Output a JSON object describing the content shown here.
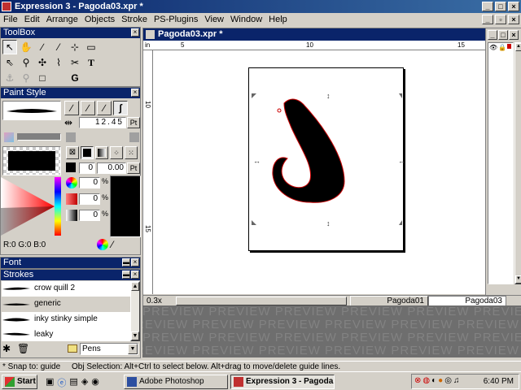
{
  "window": {
    "title": "Expression 3 - Pagoda03.xpr *"
  },
  "menu": [
    "File",
    "Edit",
    "Arrange",
    "Objects",
    "Stroke",
    "PS-Plugins",
    "View",
    "Window",
    "Help"
  ],
  "toolbox": {
    "title": "ToolBox"
  },
  "paint_style": {
    "title": "Paint Style",
    "stroke_width": "12.45",
    "stroke_unit": "Pt",
    "offset_a": "0",
    "offset_b": "0.00",
    "offset_unit": "Pt",
    "opacity_1": "0",
    "opacity_2": "0",
    "opacity_3": "0",
    "percent": "%",
    "rgb_readout": "R:0 G:0 B:0"
  },
  "font_panel": {
    "title": "Font"
  },
  "strokes_panel": {
    "title": "Strokes",
    "items": [
      "crow quill 2",
      "generic",
      "inky stinky simple",
      "leaky"
    ],
    "selected": "generic",
    "category": "Pens"
  },
  "document": {
    "title": "Pagoda03.xpr *",
    "ruler_unit": "in",
    "ruler_h": [
      "5",
      "10",
      "15"
    ],
    "ruler_v": [
      "10",
      "15"
    ],
    "zoom": "0.3x",
    "tabs": [
      "Pagoda01",
      "Pagoda03"
    ],
    "active_tab": "Pagoda03",
    "preview_text": "PREVIEW PREVIEW PREVIEW PREVIEW PREVIEW PREVIEW PREVIEW PREVIEW"
  },
  "status": {
    "left": "* Snap to: guide",
    "right": "Obj Selection: Alt+Ctrl to select below. Alt+drag to move/delete guide lines."
  },
  "taskbar": {
    "start": "Start",
    "buttons": [
      "Adobe Photoshop",
      "Expression 3 - Pagoda..."
    ],
    "clock": "6:40 PM"
  },
  "colors": {
    "title_blue": "#0a246a",
    "selection_red": "#cc0000"
  }
}
